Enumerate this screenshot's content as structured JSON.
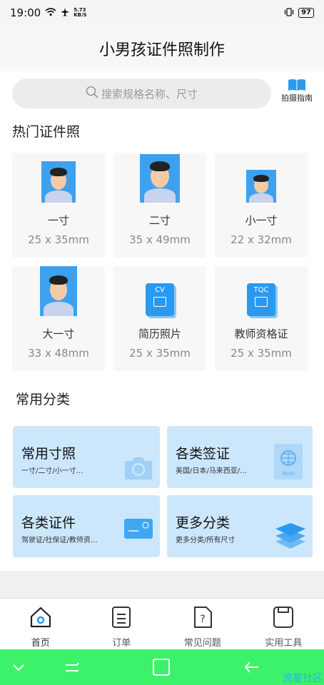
{
  "status": {
    "time": "19:00",
    "speed": "5.73 KB/S",
    "battery": "97"
  },
  "header": {
    "title": "小男孩证件照制作"
  },
  "search": {
    "placeholder": "搜索规格名称、尺寸",
    "guide_label": "拍摄指南"
  },
  "hot": {
    "title": "热门证件照",
    "items": [
      {
        "name": "一寸",
        "size": "25 x 35mm",
        "icon": "portrait-photo-icon"
      },
      {
        "name": "二寸",
        "size": "35 x 49mm",
        "icon": "portrait-photo-icon"
      },
      {
        "name": "小一寸",
        "size": "22 x 32mm",
        "icon": "portrait-photo-icon"
      },
      {
        "name": "大一寸",
        "size": "33 x 48mm",
        "icon": "portrait-photo-icon"
      },
      {
        "name": "简历照片",
        "size": "25 x 35mm",
        "icon": "cv-doc-icon",
        "badge": "CV"
      },
      {
        "name": "教师资格证",
        "size": "25 x 35mm",
        "icon": "tqc-doc-icon",
        "badge": "TQC"
      }
    ]
  },
  "common": {
    "title": "常用分类",
    "items": [
      {
        "title": "常用寸照",
        "sub": "一寸/二寸/小一寸...",
        "icon": "camera-icon"
      },
      {
        "title": "各类签证",
        "sub": "美国/日本/马来西亚/泰国...",
        "icon": "passport-icon",
        "badge": "PASS"
      },
      {
        "title": "各类证件",
        "sub": "驾驶证/社保证/教师资格证...",
        "icon": "id-card-icon"
      },
      {
        "title": "更多分类",
        "sub": "更多分类/所有尺寸",
        "icon": "layers-icon"
      }
    ]
  },
  "tabs": [
    {
      "label": "首页",
      "icon": "home-icon",
      "active": true
    },
    {
      "label": "订单",
      "icon": "orders-icon"
    },
    {
      "label": "常见问题",
      "icon": "faq-icon"
    },
    {
      "label": "实用工具",
      "icon": "tools-icon"
    }
  ],
  "watermark": "流星社区",
  "colors": {
    "accent": "#2a9af0",
    "category_bg": "#cce7fc",
    "nav_bar": "#3cf26a"
  }
}
